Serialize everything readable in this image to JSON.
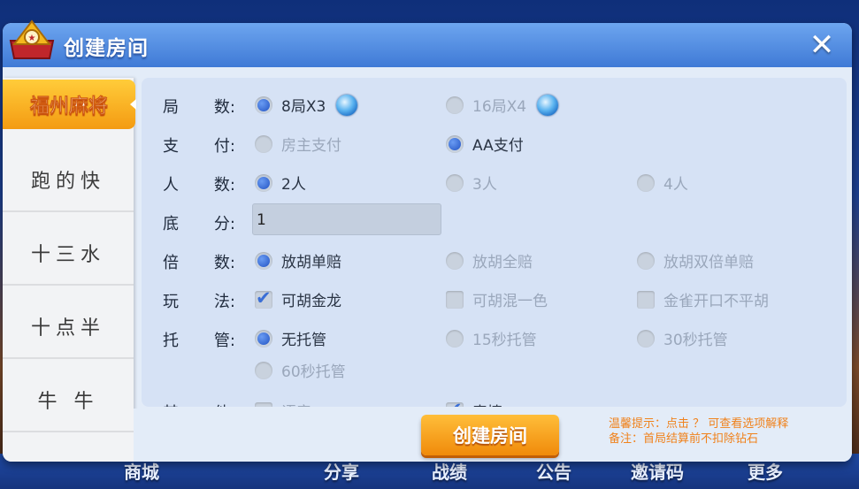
{
  "background_bar": {
    "items": [
      "商城",
      "分享",
      "战绩",
      "公告",
      "邀请码",
      "更多"
    ]
  },
  "dialog": {
    "title": "创建房间",
    "close_symbol": "✕"
  },
  "tabs": [
    {
      "label": "福州麻将",
      "active": true
    },
    {
      "label": "跑的快",
      "active": false
    },
    {
      "label": "十三水",
      "active": false
    },
    {
      "label": "十点半",
      "active": false
    },
    {
      "label": "牛 牛",
      "active": false
    }
  ],
  "settings": {
    "rounds": {
      "label_a": "局",
      "label_b": "数:",
      "options": [
        {
          "text": "8局X3",
          "checked": true,
          "icon": "diamond-icon"
        },
        {
          "text": "16局X4",
          "checked": false,
          "icon": "diamond-icon"
        }
      ]
    },
    "payment": {
      "label_a": "支",
      "label_b": "付:",
      "options": [
        {
          "text": "房主支付",
          "checked": false
        },
        {
          "text": "AA支付",
          "checked": true
        }
      ]
    },
    "players": {
      "label_a": "人",
      "label_b": "数:",
      "options": [
        {
          "text": "2人",
          "checked": true
        },
        {
          "text": "3人",
          "checked": false
        },
        {
          "text": "4人",
          "checked": false
        }
      ]
    },
    "base_score": {
      "label_a": "底",
      "label_b": "分:",
      "value": "1"
    },
    "multiplier": {
      "label_a": "倍",
      "label_b": "数:",
      "options": [
        {
          "text": "放胡单赔",
          "checked": true
        },
        {
          "text": "放胡全赔",
          "checked": false
        },
        {
          "text": "放胡双倍单赔",
          "checked": false
        }
      ]
    },
    "play_rules": {
      "label_a": "玩",
      "label_b": "法:",
      "options": [
        {
          "text": "可胡金龙",
          "checked": true
        },
        {
          "text": "可胡混一色",
          "checked": false
        },
        {
          "text": "金雀开口不平胡",
          "checked": false
        }
      ]
    },
    "hosting": {
      "label_a": "托",
      "label_b": "管:",
      "options": [
        {
          "text": "无托管",
          "checked": true
        },
        {
          "text": "15秒托管",
          "checked": false
        },
        {
          "text": "30秒托管",
          "checked": false
        },
        {
          "text": "60秒托管",
          "checked": false
        }
      ]
    },
    "other": {
      "label_a": "其",
      "label_b": "他:",
      "options": [
        {
          "text": "语音",
          "checked": false
        },
        {
          "text": "表情",
          "checked": true
        }
      ]
    }
  },
  "footer": {
    "create_button": "创建房间",
    "tip_line1": "温馨提示：点击 ？ 可查看选项解释",
    "tip_line2": "备注：首局结算前不扣除钻石"
  }
}
